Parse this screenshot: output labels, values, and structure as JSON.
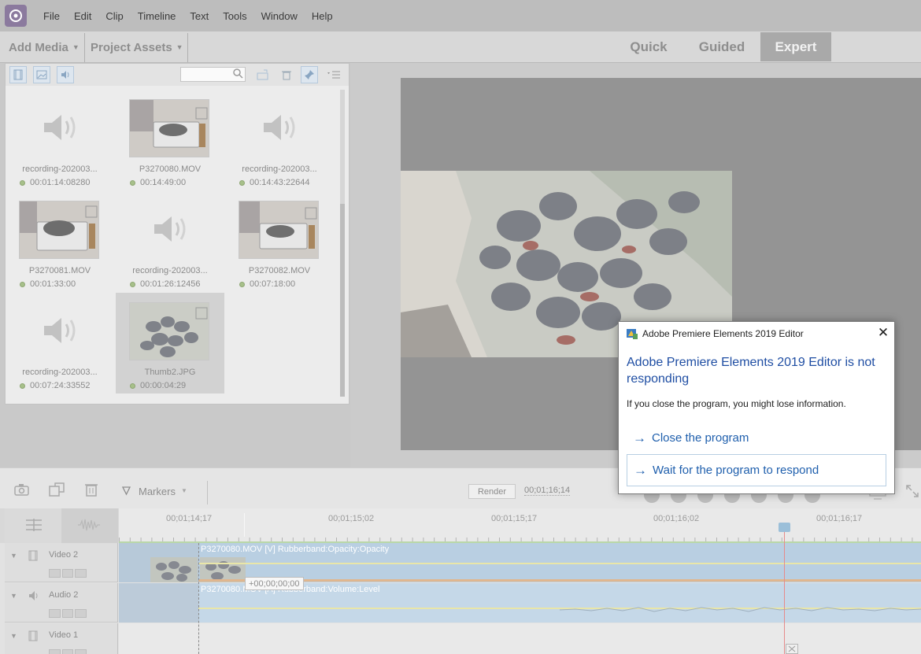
{
  "menubar": {
    "items": [
      "File",
      "Edit",
      "Clip",
      "Timeline",
      "Text",
      "Tools",
      "Window",
      "Help"
    ]
  },
  "modebar": {
    "add_media": "Add Media",
    "project_assets": "Project Assets",
    "modes": [
      "Quick",
      "Guided",
      "Expert"
    ],
    "active_mode": "Expert"
  },
  "assets": {
    "search_placeholder": "",
    "items": [
      {
        "name": "recording-202003...",
        "duration": "00:01:14:08280",
        "kind": "audio"
      },
      {
        "name": "P3270080.MOV",
        "duration": "00:14:49:00",
        "kind": "video"
      },
      {
        "name": "recording-202003...",
        "duration": "00:14:43:22644",
        "kind": "audio"
      },
      {
        "name": "P3270081.MOV",
        "duration": "00:01:33:00",
        "kind": "video"
      },
      {
        "name": "recording-202003...",
        "duration": "00:01:26:12456",
        "kind": "audio"
      },
      {
        "name": "P3270082.MOV",
        "duration": "00:07:18:00",
        "kind": "video"
      },
      {
        "name": "recording-202003...",
        "duration": "00:07:24:33552",
        "kind": "audio"
      },
      {
        "name": "Thumb2.JPG",
        "duration": "00:00:04:29",
        "kind": "image",
        "selected": true
      }
    ]
  },
  "timeline": {
    "markers_label": "Markers",
    "render_label": "Render",
    "timecode": "00;01;16;14",
    "ruler_labels": [
      "00;01;14;17",
      "00;01;15;02",
      "00;01;15;17",
      "00;01;16;02",
      "00;01;16;17"
    ],
    "tracks": [
      {
        "name": "Video 2",
        "clip_label": "P3270080.MOV [V] Rubberband:Opacity:Opacity"
      },
      {
        "name": "Audio 2",
        "clip_label": "P3270080.MOV [A] Rubberband:Volume:Level"
      },
      {
        "name": "Video 1",
        "clip_label": ""
      }
    ],
    "offset_tooltip": "+00;00;00;00"
  },
  "dialog": {
    "title": "Adobe Premiere Elements 2019 Editor",
    "heading": "Adobe Premiere Elements 2019 Editor is not responding",
    "info": "If you close the program, you might lose information.",
    "close_option": "Close the program",
    "wait_option": "Wait for the program to respond"
  },
  "colors": {
    "dialog_link": "#1f5fad",
    "clip_blue": "#b9cfe2",
    "playhead": "#e68b8b"
  }
}
